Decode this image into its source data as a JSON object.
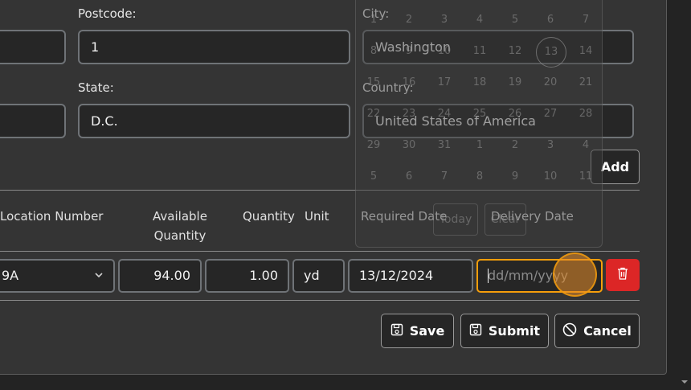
{
  "address": {
    "postcode_label": "Postcode:",
    "postcode_value": "1",
    "city_label": "City:",
    "city_value": "Washington",
    "state_label": "State:",
    "state_value": "D.C.",
    "country_label": "Country:",
    "country_value": "United States of America"
  },
  "add_label": "Add",
  "table": {
    "headers": {
      "location_number": "Location Number",
      "available_quantity": "Available Quantity",
      "quantity": "Quantity",
      "unit": "Unit",
      "required_date": "Required Date",
      "delivery_date": "Delivery Date"
    },
    "row": {
      "location": "9A",
      "available": "94.00",
      "quantity": "1.00",
      "unit": "yd",
      "required_date": "13/12/2024",
      "delivery_placeholder": "dd/mm/yyyy"
    }
  },
  "buttons": {
    "save": "Save",
    "submit": "Submit",
    "cancel": "Cancel"
  },
  "calendar": {
    "weeks": [
      [
        "1",
        "2",
        "3",
        "4",
        "5",
        "6",
        "7"
      ],
      [
        "8",
        "9",
        "10",
        "11",
        "12",
        "13",
        "14"
      ],
      [
        "15",
        "16",
        "17",
        "18",
        "19",
        "20",
        "21"
      ],
      [
        "22",
        "23",
        "24",
        "25",
        "26",
        "27",
        "28"
      ],
      [
        "29",
        "30",
        "31",
        "1",
        "2",
        "3",
        "4"
      ],
      [
        "5",
        "6",
        "7",
        "8",
        "9",
        "10",
        "11"
      ]
    ],
    "today_label": "Today",
    "clear_label": "Clear",
    "selected_day": "13"
  },
  "colors": {
    "delete": "#dc2626",
    "focus": "#f59e0b",
    "accent": "#f59e0b"
  }
}
